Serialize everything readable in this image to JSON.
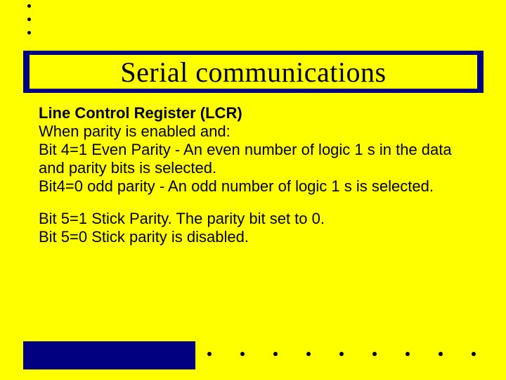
{
  "title": "Serial communications",
  "heading": "Line Control Register (LCR)",
  "para1_line1": "When parity is enabled and:",
  "para1_line2": "Bit 4=1 Even Parity - An even number of logic 1 s in the data and parity bits is selected.",
  "para1_line3": "Bit4=0 odd parity - An odd number of logic 1 s is selected.",
  "para2_line1": "Bit 5=1 Stick Parity. The parity bit set to 0.",
  "para2_line2": "Bit 5=0 Stick parity is disabled."
}
